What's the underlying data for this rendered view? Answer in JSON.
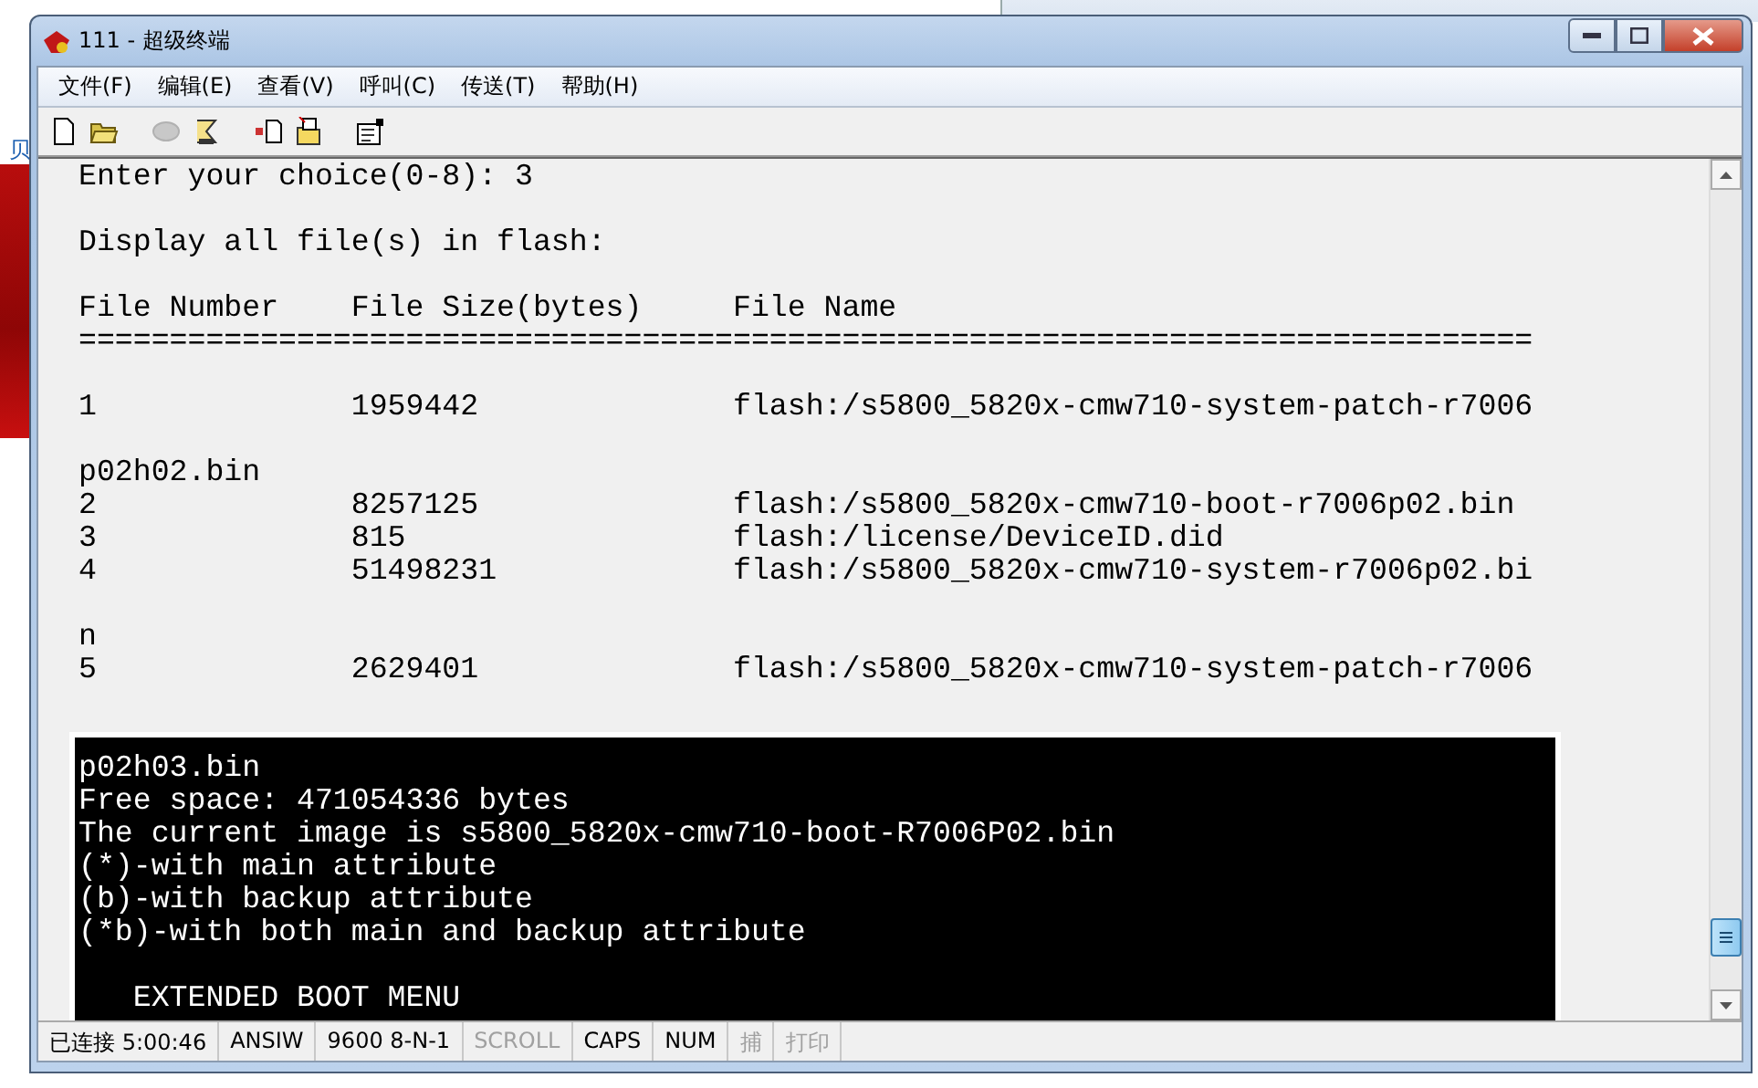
{
  "desktop": {
    "side_link": "贝"
  },
  "window": {
    "title": "111 - 超级终端",
    "active": true
  },
  "menu": [
    "文件(F)",
    "编辑(E)",
    "查看(V)",
    "呼叫(C)",
    "传送(T)",
    "帮助(H)"
  ],
  "toolbar": [
    {
      "kind": "new",
      "disabled": false
    },
    {
      "kind": "open",
      "disabled": false
    },
    {
      "kind": "sep"
    },
    {
      "kind": "disconnect",
      "disabled": true
    },
    {
      "kind": "dial",
      "disabled": false
    },
    {
      "kind": "sep"
    },
    {
      "kind": "send",
      "disabled": false
    },
    {
      "kind": "receive",
      "disabled": false
    },
    {
      "kind": "sep"
    },
    {
      "kind": "properties",
      "disabled": false
    }
  ],
  "terminal": {
    "blocks": [
      [
        "Enter your choice(0-8): 3"
      ],
      [
        "Display all file(s) in flash:"
      ],
      [
        "File Number    File Size(bytes)     File Name",
        "================================================================================"
      ],
      [
        "1              1959442              flash:/s5800_5820x-cmw710-system-patch-r7006"
      ],
      [
        "p02h02.bin",
        "2              8257125              flash:/s5800_5820x-cmw710-boot-r7006p02.bin",
        "3              815                  flash:/license/DeviceID.did",
        "4              51498231             flash:/s5800_5820x-cmw710-system-r7006p02.bi"
      ],
      [
        "n",
        "5              2629401              flash:/s5800_5820x-cmw710-system-patch-r7006"
      ]
    ],
    "overlay_blocks": [
      [
        "p02h03.bin",
        "Free space: 471054336 bytes",
        "The current image is s5800_5820x-cmw710-boot-R7006P02.bin",
        "(*)-with main attribute",
        "(b)-with backup attribute",
        "(*b)-with both main and backup attribute"
      ],
      [
        "   EXTENDED BOOT MENU"
      ]
    ]
  },
  "status_bar": [
    {
      "text": "已连接 5:00:46",
      "disabled": false
    },
    {
      "text": "ANSIW",
      "disabled": false
    },
    {
      "text": "9600 8-N-1",
      "disabled": false
    },
    {
      "text": "SCROLL",
      "disabled": true
    },
    {
      "text": "CAPS",
      "disabled": false
    },
    {
      "text": "NUM",
      "disabled": false
    },
    {
      "text": "捕",
      "disabled": true
    },
    {
      "text": "打印",
      "disabled": true
    }
  ]
}
